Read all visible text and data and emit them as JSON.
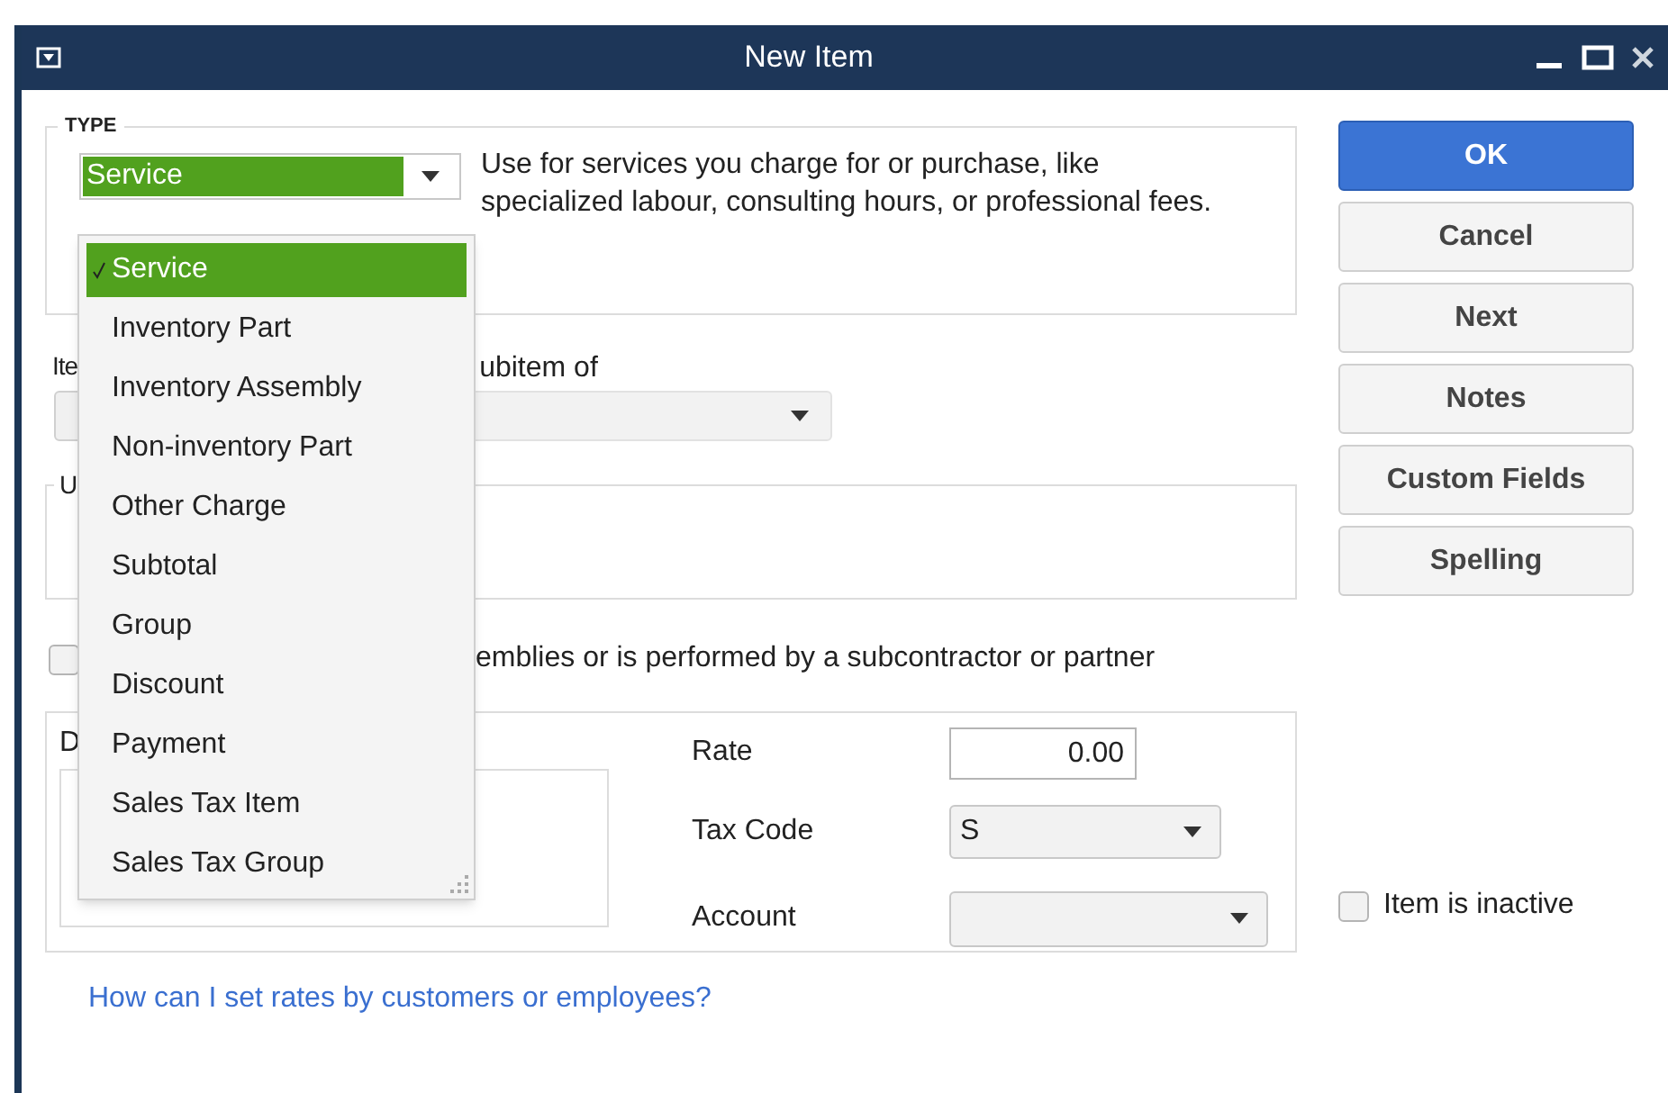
{
  "window": {
    "title": "New Item"
  },
  "type_section": {
    "legend": "TYPE",
    "selected_type": "Service",
    "description": "Use for services you charge for or purchase, like specialized labour, consulting hours, or professional fees."
  },
  "type_menu": {
    "items": [
      {
        "label": "Service",
        "selected": true
      },
      {
        "label": "Inventory Part",
        "selected": false
      },
      {
        "label": "Inventory Assembly",
        "selected": false
      },
      {
        "label": "Non-inventory Part",
        "selected": false
      },
      {
        "label": "Other Charge",
        "selected": false
      },
      {
        "label": "Subtotal",
        "selected": false
      },
      {
        "label": "Group",
        "selected": false
      },
      {
        "label": "Discount",
        "selected": false
      },
      {
        "label": "Payment",
        "selected": false
      },
      {
        "label": "Sales Tax Item",
        "selected": false
      },
      {
        "label": "Sales Tax Group",
        "selected": false
      }
    ]
  },
  "item_row": {
    "label_1": "Ite",
    "label_2": "ubitem of"
  },
  "unit_section": {
    "label": "U"
  },
  "subcontractor": {
    "label": "emblies or is performed by a subcontractor or partner",
    "checked": false
  },
  "rate_section": {
    "label": "D",
    "rate_label": "Rate",
    "rate_value": "0.00",
    "tax_code_label": "Tax Code",
    "tax_code_value": "S",
    "account_label": "Account"
  },
  "inactive": {
    "label": "Item is inactive",
    "checked": false
  },
  "help_link": "How can I set rates by customers or employees?",
  "buttons": [
    {
      "label": "OK",
      "kind": "default"
    },
    {
      "label": "Cancel",
      "kind": "normal"
    },
    {
      "label": "Next",
      "kind": "normal"
    },
    {
      "label": "Notes",
      "kind": "normal"
    },
    {
      "label": "Custom Fields",
      "kind": "normal"
    },
    {
      "label": "Spelling",
      "kind": "normal"
    }
  ]
}
